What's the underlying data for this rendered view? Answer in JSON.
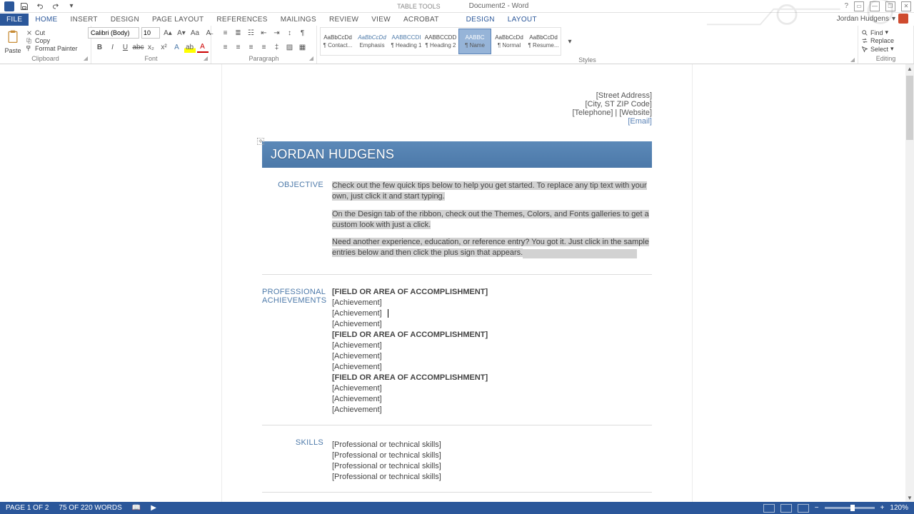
{
  "titlebar": {
    "contextual": "TABLE TOOLS",
    "docname": "Document2 - Word"
  },
  "tabs": {
    "file": "FILE",
    "items": [
      "HOME",
      "INSERT",
      "DESIGN",
      "PAGE LAYOUT",
      "REFERENCES",
      "MAILINGS",
      "REVIEW",
      "VIEW",
      "ACROBAT"
    ],
    "context": [
      "DESIGN",
      "LAYOUT"
    ],
    "account": "Jordan Hudgens"
  },
  "ribbon": {
    "clipboard": {
      "paste": "Paste",
      "cut": "Cut",
      "copy": "Copy",
      "fmt": "Format Painter",
      "label": "Clipboard"
    },
    "font": {
      "name": "Calibri (Body)",
      "size": "10",
      "label": "Font"
    },
    "paragraph": {
      "label": "Paragraph"
    },
    "styles": {
      "label": "Styles",
      "items": [
        {
          "preview": "AaBbCcDd",
          "name": "¶ Contact..."
        },
        {
          "preview": "AaBbCcDd",
          "name": "Emphasis",
          "color": "#4c79a9",
          "italic": true
        },
        {
          "preview": "AABBCCDI",
          "name": "¶ Heading 1",
          "color": "#4c79a9"
        },
        {
          "preview": "AABBCCDD",
          "name": "¶ Heading 2"
        },
        {
          "preview": "AABBC",
          "name": "¶ Name",
          "selected": true,
          "color": "#fff"
        },
        {
          "preview": "AaBbCcDd",
          "name": "¶ Normal"
        },
        {
          "preview": "AaBbCcDd",
          "name": "¶ Resume..."
        }
      ]
    },
    "editing": {
      "find": "Find",
      "replace": "Replace",
      "select": "Select",
      "label": "Editing"
    }
  },
  "doc": {
    "address": {
      "street": "[Street Address]",
      "city": "[City, ST ZIP Code]",
      "tel_web": "[Telephone] | [Website]",
      "email": "[Email]"
    },
    "name": "JORDAN HUDGENS",
    "objective": {
      "h": "OBJECTIVE",
      "p1": "Check out the few quick tips below to help you get started. To replace any tip text with your own, just click it and start typing.",
      "p2": "On the Design tab of the ribbon, check out the Themes, Colors, and Fonts galleries to get a custom look with just a click.",
      "p3": "Need another experience, education, or reference entry? You got it. Just click in the sample entries below and then click the plus sign that appears."
    },
    "prof": {
      "h1": "PROFESSIONAL",
      "h2": "ACHIEVEMENTS",
      "field": "[FIELD OR AREA OF ACCOMPLISHMENT]",
      "ach": "[Achievement]"
    },
    "skills": {
      "h": "SKILLS",
      "item": "[Professional or technical skills]"
    }
  },
  "status": {
    "page": "PAGE 1 OF 2",
    "words": "75 OF 220 WORDS",
    "zoom": "120%"
  }
}
